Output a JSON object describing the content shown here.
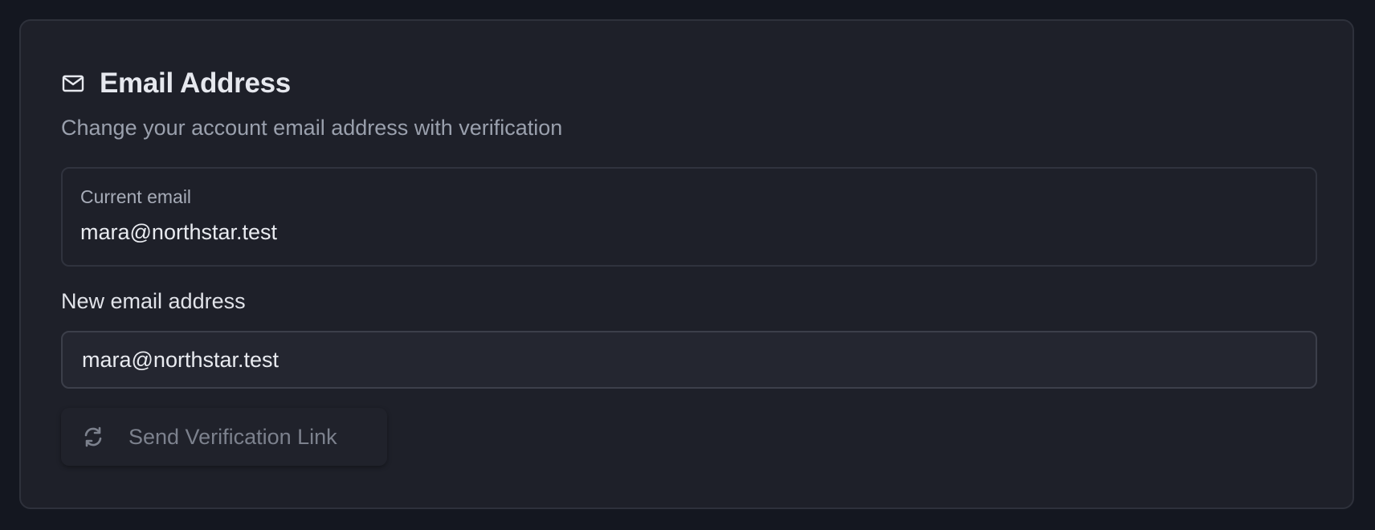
{
  "section": {
    "title": "Email Address",
    "title_icon": "mail-icon",
    "subtitle": "Change your account email address with verification"
  },
  "current_email": {
    "label": "Current email",
    "value": "mara@northstar.test"
  },
  "new_email": {
    "label": "New email address",
    "value": "mara@northstar.test",
    "placeholder": ""
  },
  "send_button": {
    "label": "Send Verification Link",
    "icon": "refresh-icon",
    "disabled": true
  },
  "colors": {
    "page_background": "#141720",
    "card_background": "#1e2029",
    "card_border": "#2e313b",
    "title_text": "#e6e8ee",
    "muted_text": "#9aa0ad",
    "disabled_text": "#7c818d"
  }
}
